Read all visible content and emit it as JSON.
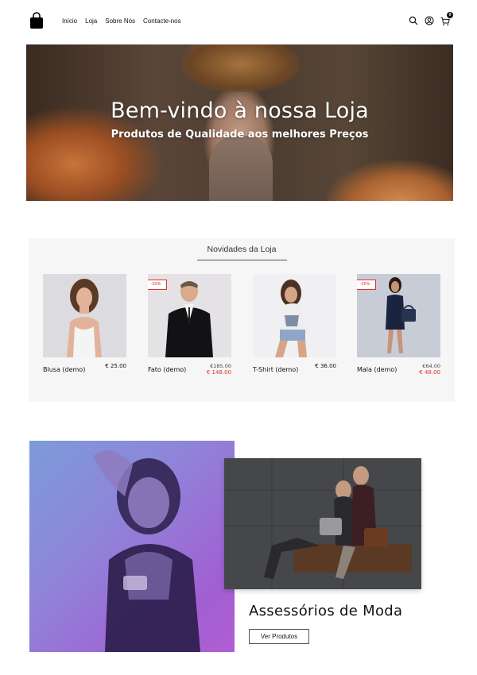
{
  "nav": {
    "items": [
      {
        "label": "Início"
      },
      {
        "label": "Loja"
      },
      {
        "label": "Sobre Nós"
      },
      {
        "label": "Contacte-nos"
      }
    ],
    "cart_count": "0"
  },
  "hero": {
    "title": "Bem-vindo à nossa Loja",
    "subtitle": "Produtos de Qualidade aos melhores Preços"
  },
  "products": {
    "title": "Novidades da Loja",
    "items": [
      {
        "name": "Blusa (demo)",
        "price": "€ 25.00",
        "badge": "",
        "old_price": "",
        "new_price": ""
      },
      {
        "name": "Fato (demo)",
        "price": "",
        "badge": "-20%",
        "old_price": "€185.00",
        "new_price": "€ 148.00"
      },
      {
        "name": "T-Shirt (demo)",
        "price": "€ 36.00",
        "badge": "",
        "old_price": "",
        "new_price": ""
      },
      {
        "name": "Mala (demo)",
        "price": "",
        "badge": "-25%",
        "old_price": "€64.00",
        "new_price": "€ 48.00"
      }
    ]
  },
  "promo": {
    "title": "Assessórios de Moda",
    "button": "Ver Produtos"
  },
  "colors": {
    "accent_red": "#e0312d",
    "section_bg": "#f6f6f6"
  }
}
